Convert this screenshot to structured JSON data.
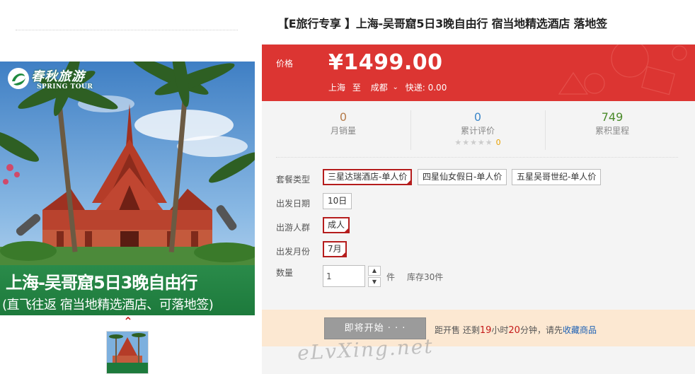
{
  "gallery": {
    "logo_cn": "春秋旅游",
    "logo_en": "SPRING TOUR",
    "image_title": "上海-吴哥窟5日3晚自由行",
    "image_subtitle": "(直飞往返 宿当地精选酒店、可落地签)",
    "up_arrow": "⌃"
  },
  "product": {
    "title": "【E旅行专享 】上海-吴哥窟5日3晚自由行 宿当地精选酒店 落地签"
  },
  "price": {
    "label": "价格",
    "value": "¥1499.00",
    "from": "上海",
    "to_word": "至",
    "destination": "成都",
    "chevron": "⌄",
    "shipping": "快递: 0.00"
  },
  "stats": {
    "sales_value": "0",
    "sales_label": "月销量",
    "reviews_value": "0",
    "reviews_label": "累计评价",
    "rating_stars": "★★★★★",
    "rating_count": "0",
    "points_value": "749",
    "points_label": "累积里程"
  },
  "options": {
    "package_label": "套餐类型",
    "packages": [
      "三星达瑞酒店-单人价",
      "四星仙女假日-单人价",
      "五星吴哥世纪-单人价"
    ],
    "date_label": "出发日期",
    "date_value": "10日",
    "group_label": "出游人群",
    "group_value": "成人",
    "month_label": "出发月份",
    "month_value": "7月",
    "qty_label": "数量",
    "qty_value": "1",
    "qty_up": "▲",
    "qty_down": "▼",
    "qty_unit": "件",
    "stock": "库存30件"
  },
  "action": {
    "start_button": "即将开始 · · ·",
    "countdown_prefix": "距开售  还剩",
    "hours": "19",
    "hours_unit": "小时",
    "minutes": "20",
    "minutes_unit": "分钟，请先",
    "favorite_link": "收藏商品"
  },
  "watermark": "eLvXing.net",
  "colors": {
    "price_bg": "#dc3532",
    "selected_border": "#b51d1d",
    "action_bg": "#fce8d2",
    "start_button_bg": "#9b9b9b",
    "banner_green": "#1d7a3c"
  }
}
